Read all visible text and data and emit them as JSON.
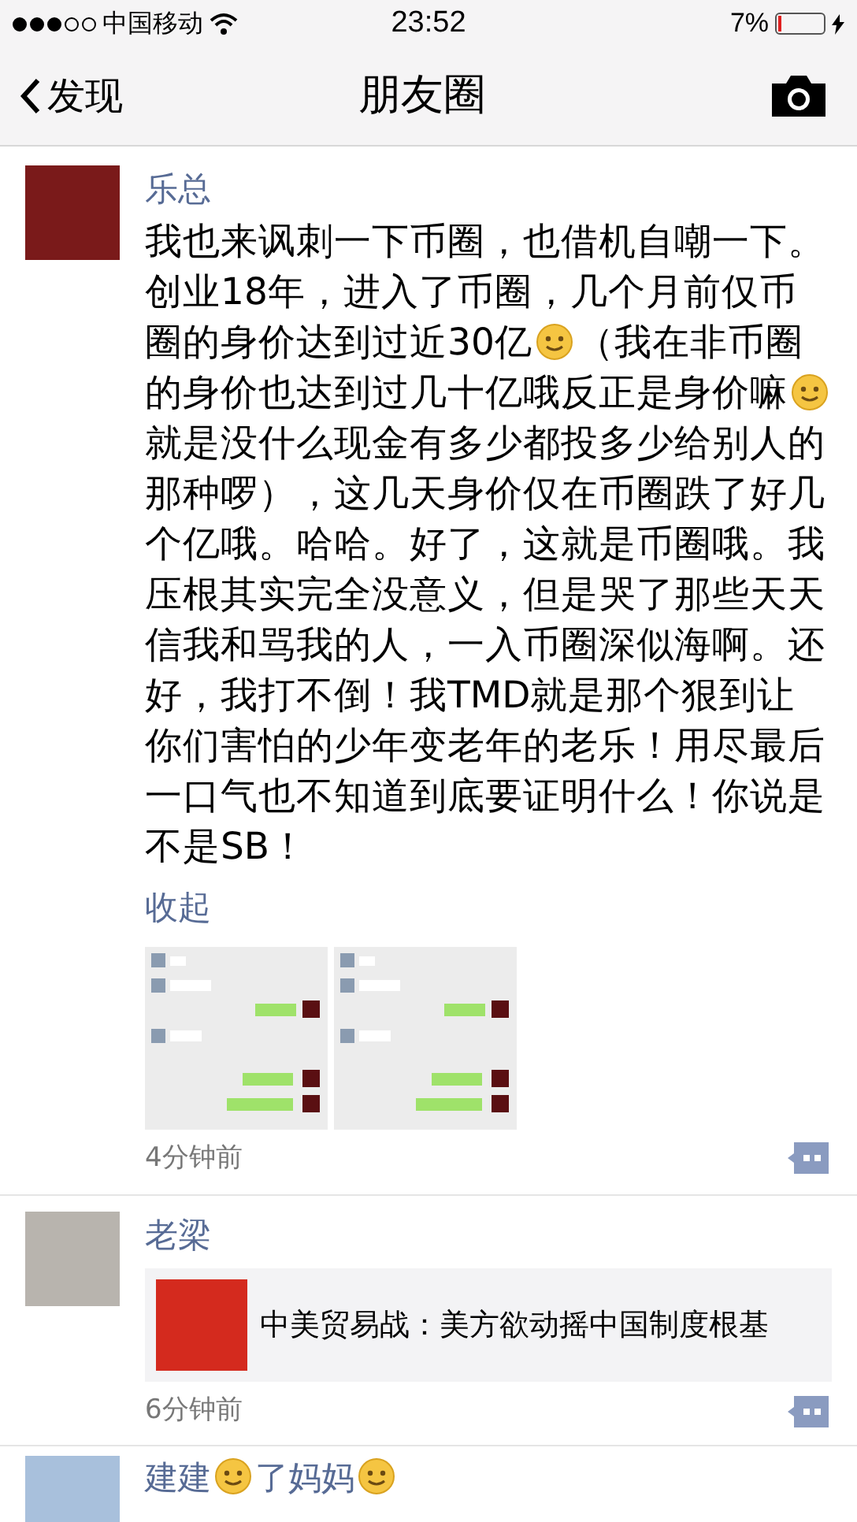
{
  "status_bar": {
    "carrier": "中国移动",
    "time": "23:52",
    "battery_text": "7%",
    "battery": {
      "level": 0.07
    },
    "charging": true
  },
  "nav": {
    "back": "发现",
    "title": "朋友圈"
  },
  "posts": [
    {
      "name": [
        {
          "kind": "text",
          "text": "乐总"
        }
      ],
      "body": [
        {
          "kind": "text",
          "text": "我也来讽刺一下币圈，也借机自嘲一下。创业18年，进入了币圈，几个月前仅币圈的身价达到过近30亿"
        },
        {
          "kind": "emoji"
        },
        {
          "kind": "text",
          "text": "（我在非币圈的身价也达到过几十亿哦反正是身价嘛"
        },
        {
          "kind": "emoji"
        },
        {
          "kind": "text",
          "text": "就是没什么现金有多少都投多少给别人的那种啰），这几天身价仅在币圈跌了好几个亿哦。哈哈。好了，这就是币圈哦。我压根其实完全没意义，但是哭了那些天天信我和骂我的人，一入币圈深似海啊。还好，我打不倒！我TMD就是那个狠到让你们害怕的少年变老年的老乐！用尽最后一口气也不知道到底要证明什么！你说是不是SB！"
        }
      ],
      "collapse": "收起",
      "time": "4分钟前"
    },
    {
      "name": [
        {
          "kind": "text",
          "text": "老梁"
        }
      ],
      "link": {
        "title": "中美贸易战：美方欲动摇中国制度根基"
      },
      "time": "6分钟前"
    },
    {
      "name": [
        {
          "kind": "text",
          "text": "建建"
        },
        {
          "kind": "emoji"
        },
        {
          "kind": "text",
          "text": "了妈妈"
        },
        {
          "kind": "emoji"
        }
      ]
    }
  ]
}
